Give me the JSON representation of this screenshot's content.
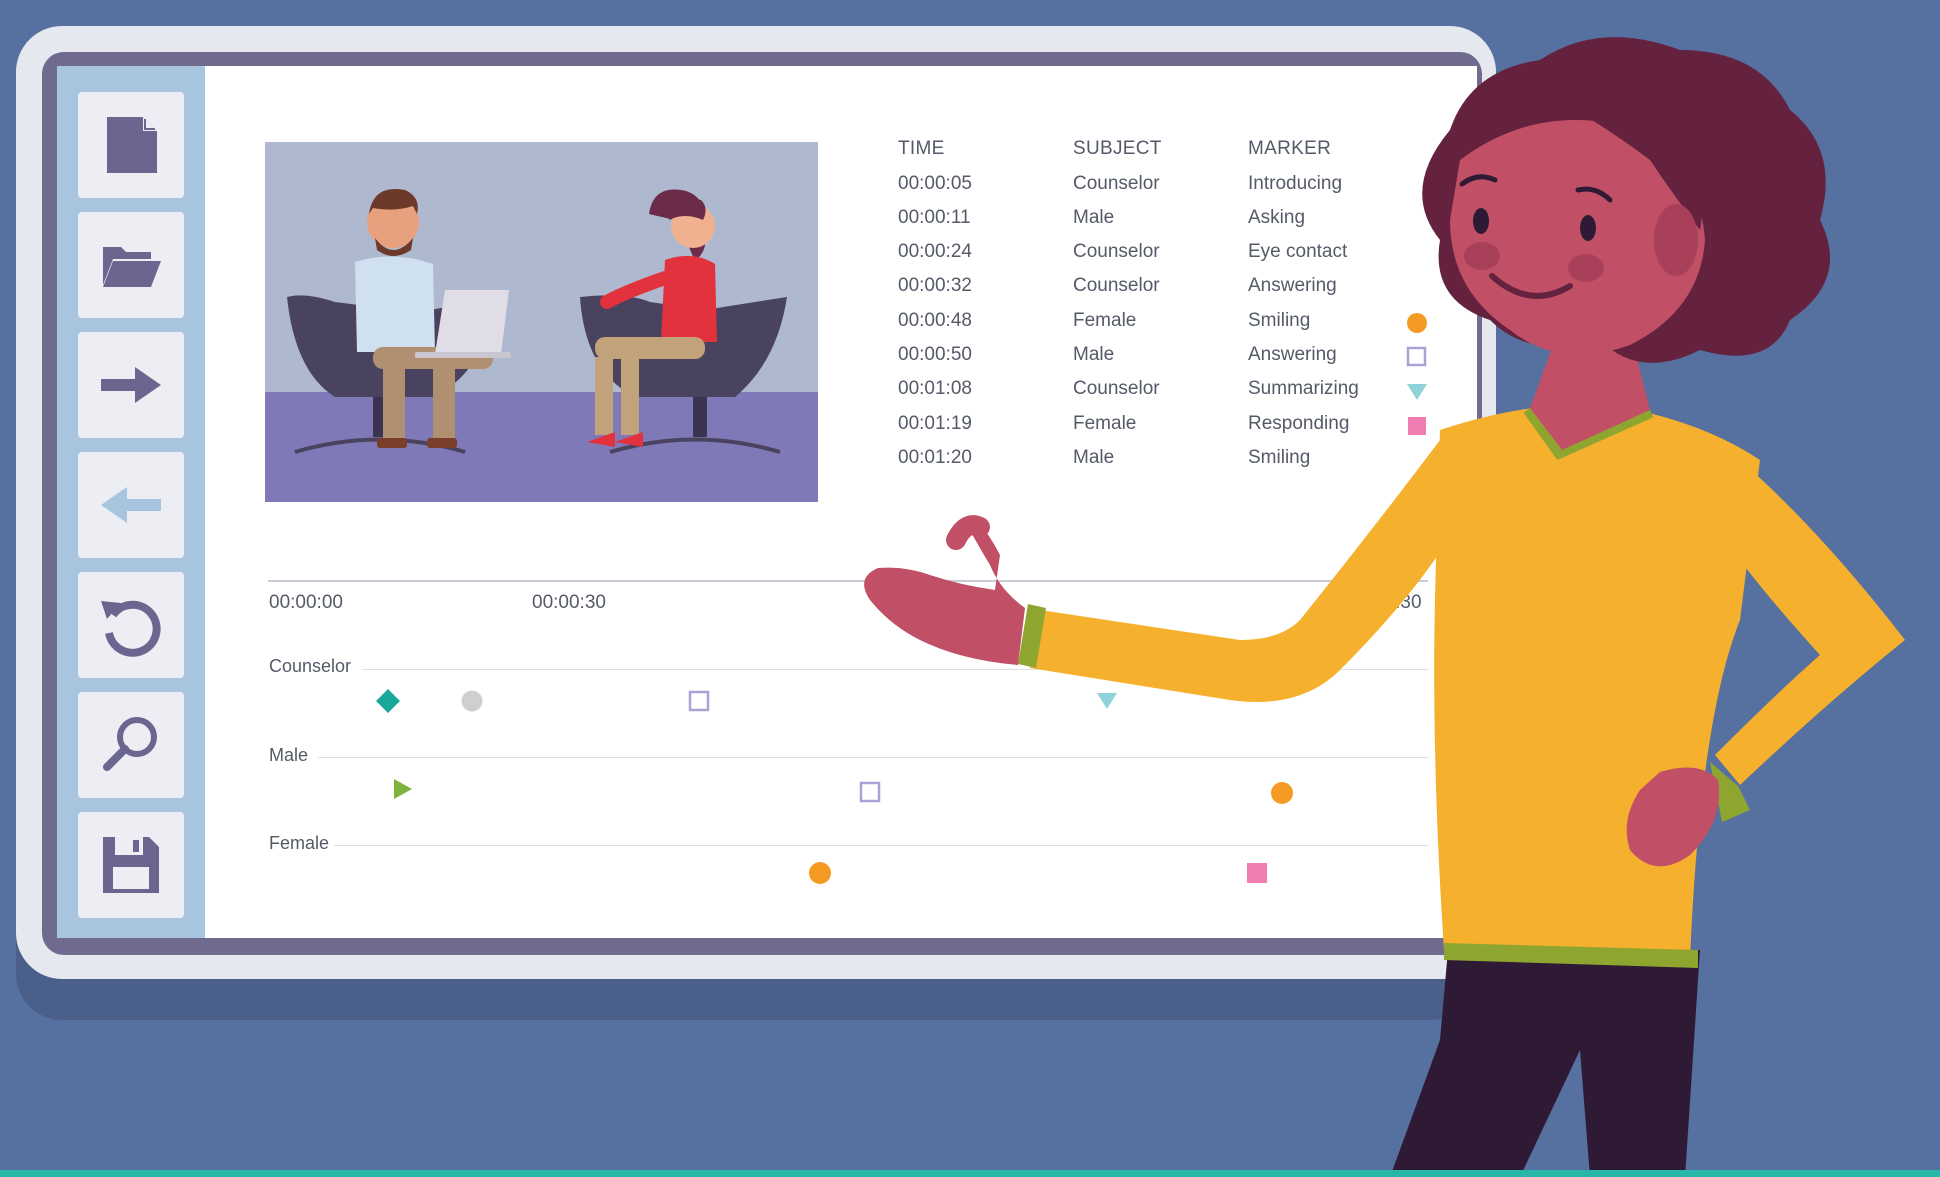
{
  "toolbar": {
    "buttons": [
      {
        "icon": "new-file-icon"
      },
      {
        "icon": "open-folder-icon"
      },
      {
        "icon": "forward-arrow-icon"
      },
      {
        "icon": "back-arrow-icon"
      },
      {
        "icon": "refresh-icon"
      },
      {
        "icon": "search-icon"
      },
      {
        "icon": "save-icon"
      }
    ]
  },
  "table": {
    "headers": {
      "time": "TIME",
      "subject": "SUBJECT",
      "marker": "MARKER"
    },
    "rows": [
      {
        "time": "00:00:05",
        "subject": "Counselor",
        "marker": "Introducing"
      },
      {
        "time": "00:00:11",
        "subject": "Male",
        "marker": "Asking"
      },
      {
        "time": "00:00:24",
        "subject": "Counselor",
        "marker": "Eye contact"
      },
      {
        "time": "00:00:32",
        "subject": "Counselor",
        "marker": "Answering"
      },
      {
        "time": "00:00:48",
        "subject": "Female",
        "marker": "Smiling"
      },
      {
        "time": "00:00:50",
        "subject": "Male",
        "marker": "Answering"
      },
      {
        "time": "00:01:08",
        "subject": "Counselor",
        "marker": "Summarizing"
      },
      {
        "time": "00:01:19",
        "subject": "Female",
        "marker": "Responding"
      },
      {
        "time": "00:01:20",
        "subject": "Male",
        "marker": "Smiling"
      }
    ]
  },
  "timeline": {
    "ticks": [
      "00:00:00",
      "00:00:30",
      "01:30"
    ],
    "tracks": [
      "Counselor",
      "Male",
      "Female"
    ]
  },
  "colors": {
    "background": "#5670a0",
    "sidebar": "#a8c5e0",
    "icon": "#6b6690",
    "orange": "#f59a23",
    "teal": "#1aa89a",
    "green": "#7fb33d",
    "lavender": "#a8a3d4",
    "cyan": "#8fd3d9",
    "pink": "#f07cb1",
    "gray": "#cfcfcf"
  }
}
